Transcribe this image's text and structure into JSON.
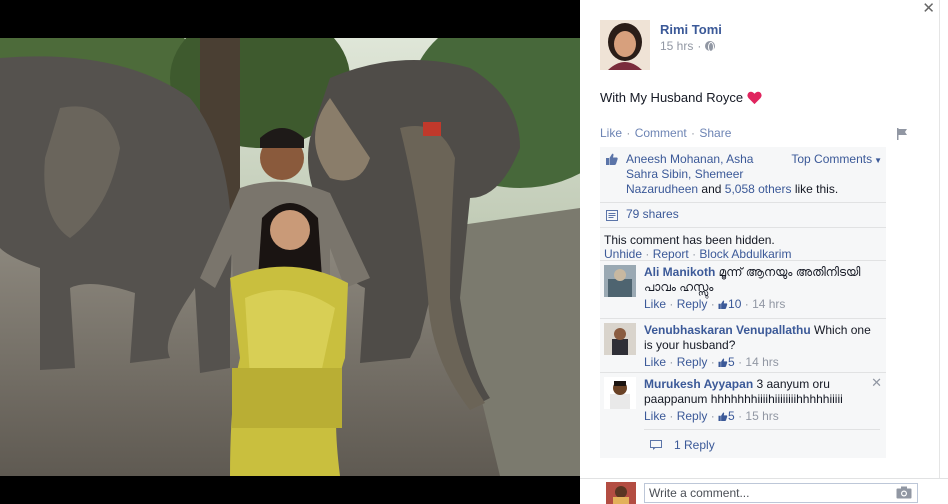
{
  "post": {
    "author": "Rimi Tomi",
    "time": "15 hrs",
    "text": "With My Husband Royce",
    "actions": {
      "like": "Like",
      "comment": "Comment",
      "share": "Share"
    }
  },
  "likes": {
    "names_line1": "Aneesh Mohanan, Asha",
    "names_line2": "Sahra Sibin, Shemeer",
    "names_line3": "Nazarudheen",
    "and_text": " and ",
    "others": "5,058 others",
    "suffix": " like this.",
    "top_comments": "Top Comments"
  },
  "shares": "79 shares",
  "hidden_comment": {
    "text": "This comment has been hidden.",
    "unhide": "Unhide",
    "report": "Report",
    "block": "Block Abdulkarim"
  },
  "comments": [
    {
      "name": "Ali Manikoth",
      "text_line1": " മൂന്ന് ആനയും അതിനിടയി",
      "text_line2": "പാവം ഹസ്സും",
      "like": "Like",
      "reply": "Reply",
      "likes": "10",
      "time": "14 hrs"
    },
    {
      "name": "Venubhaskaran Venupallathu",
      "text_line1": " Which one",
      "text_line2": "is your husband?",
      "like": "Like",
      "reply": "Reply",
      "likes": "5",
      "time": "14 hrs"
    },
    {
      "name": "Murukesh Ayyapan",
      "text_line1": " 3 aanyum oru",
      "text_line2": "paappanum hhhhhhhiiiihiiiiiiiihhhhhiiiii",
      "like": "Like",
      "reply": "Reply",
      "likes": "5",
      "time": "15 hrs"
    }
  ],
  "reply_count": "1 Reply",
  "composer": {
    "placeholder": "Write a comment..."
  },
  "colors": {
    "link": "#3b5998",
    "muted": "#9197a3",
    "ufi_bg": "#f6f7f8",
    "heart": "#e0245e"
  },
  "icons": [
    "close-icon",
    "globe-icon",
    "heart-icon",
    "flag-icon",
    "thumbs-up-icon",
    "share-icon",
    "reply-icon",
    "camera-icon"
  ]
}
